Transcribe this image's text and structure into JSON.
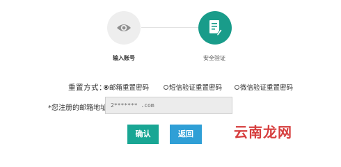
{
  "steps": [
    {
      "label": "输入账号",
      "icon": "eye-icon",
      "state": "done"
    },
    {
      "label": "安全验证",
      "icon": "form-edit-icon",
      "state": "active"
    }
  ],
  "reset_method": {
    "label": "重置方式：",
    "options": [
      {
        "label": "邮箱重置密码",
        "selected": true
      },
      {
        "label": "短信验证重置密码",
        "selected": false
      },
      {
        "label": "微信验证重置密码",
        "selected": false
      }
    ]
  },
  "email": {
    "label": "*您注册的邮箱地址：",
    "value": "2*******          .com"
  },
  "buttons": {
    "confirm": "确认",
    "back": "返回"
  },
  "watermark": "云南龙网",
  "colors": {
    "accent": "#199c8a",
    "confirm_button": "#19a694",
    "back_button": "#2f9fd6",
    "step_inactive": "#eeeeee",
    "watermark": "#d22a2a"
  }
}
